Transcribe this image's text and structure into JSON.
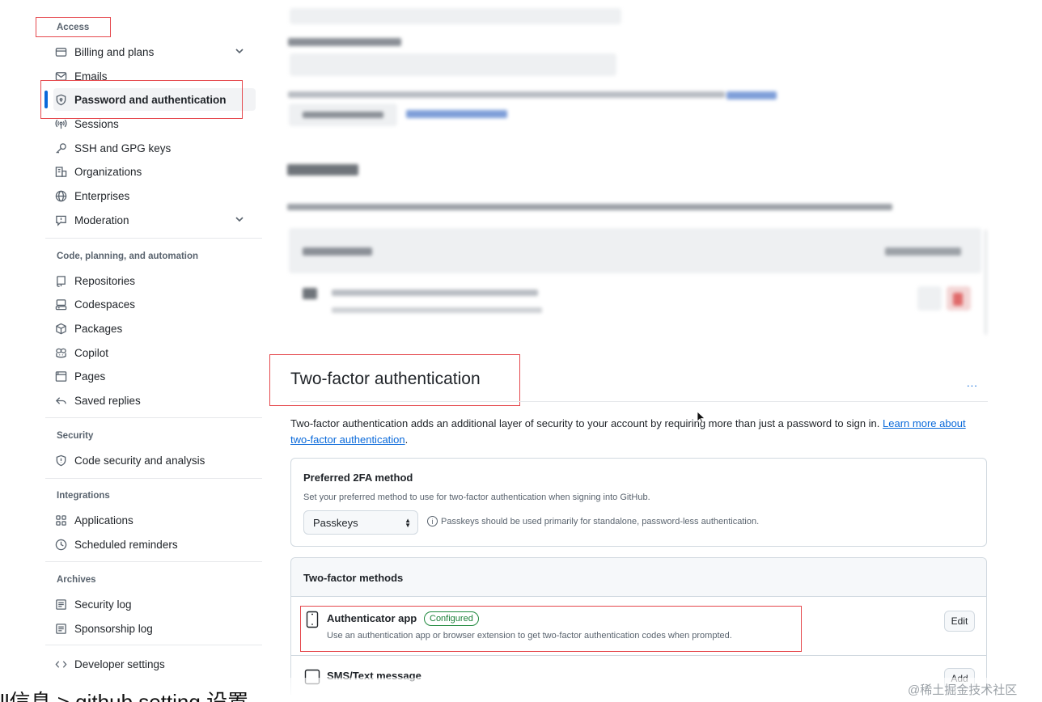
{
  "sidebar": {
    "access_heading": "Access",
    "access_items": [
      {
        "label": "Billing and plans",
        "icon": "credit-card-icon",
        "chevron": true
      },
      {
        "label": "Emails",
        "icon": "mail-icon"
      },
      {
        "label": "Password and authentication",
        "icon": "shield-lock-icon",
        "active": true
      },
      {
        "label": "Sessions",
        "icon": "broadcast-icon"
      },
      {
        "label": "SSH and GPG keys",
        "icon": "key-icon"
      },
      {
        "label": "Organizations",
        "icon": "organization-icon"
      },
      {
        "label": "Enterprises",
        "icon": "globe-icon"
      },
      {
        "label": "Moderation",
        "icon": "report-icon",
        "chevron": true
      }
    ],
    "code_heading": "Code, planning, and automation",
    "code_items": [
      {
        "label": "Repositories",
        "icon": "repo-icon"
      },
      {
        "label": "Codespaces",
        "icon": "codespaces-icon"
      },
      {
        "label": "Packages",
        "icon": "package-icon"
      },
      {
        "label": "Copilot",
        "icon": "copilot-icon"
      },
      {
        "label": "Pages",
        "icon": "browser-icon"
      },
      {
        "label": "Saved replies",
        "icon": "reply-icon"
      }
    ],
    "security_heading": "Security",
    "security_items": [
      {
        "label": "Code security and analysis",
        "icon": "shield-icon"
      }
    ],
    "integrations_heading": "Integrations",
    "integrations_items": [
      {
        "label": "Applications",
        "icon": "apps-icon"
      },
      {
        "label": "Scheduled reminders",
        "icon": "clock-icon"
      }
    ],
    "archives_heading": "Archives",
    "archives_items": [
      {
        "label": "Security log",
        "icon": "log-icon"
      },
      {
        "label": "Sponsorship log",
        "icon": "log-icon"
      }
    ],
    "developer_settings": "Developer settings"
  },
  "two_factor": {
    "title": "Two-factor authentication",
    "more": "...",
    "description": "Two-factor authentication adds an additional layer of security to your account by requiring more than just a password to sign in.",
    "learn_more": "Learn more about two-factor authentication",
    "period": ".",
    "preferred": {
      "title": "Preferred 2FA method",
      "subtitle": "Set your preferred method to use for two-factor authentication when signing into GitHub.",
      "selected": "Passkeys",
      "note": "Passkeys should be used primarily for standalone, password-less authentication."
    },
    "methods": {
      "title": "Two-factor methods",
      "authenticator": {
        "title": "Authenticator app",
        "badge": "Configured",
        "description": "Use an authentication app or browser extension to get two-factor authentication codes when prompted.",
        "button": "Edit"
      },
      "sms": {
        "title": "SMS/Text message",
        "button": "Add"
      }
    }
  },
  "caption": "ll信息 > github setting 设置",
  "watermark": "@稀土掘金技术社区",
  "colors": {
    "accent": "#0969da",
    "highlight": "#e5484d",
    "configured": "#1a7f37"
  }
}
